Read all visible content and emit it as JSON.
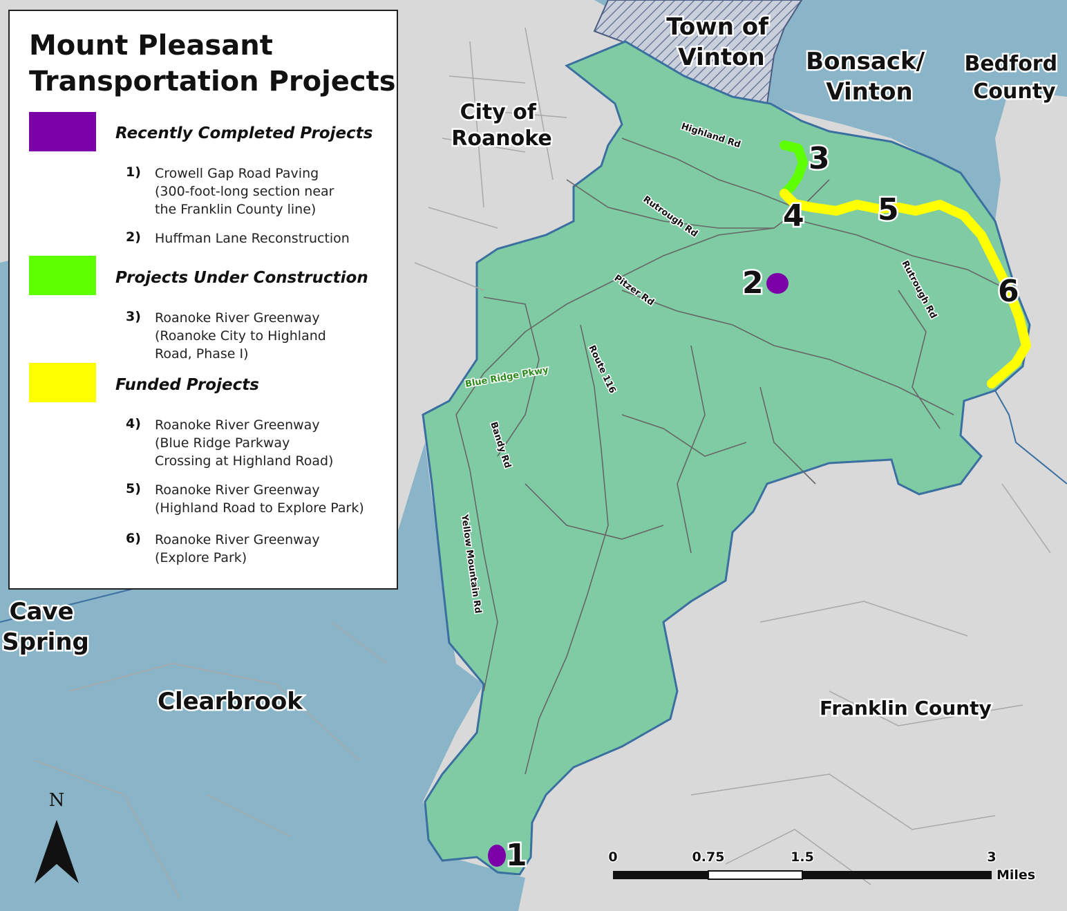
{
  "legend": {
    "title_line1": "Mount Pleasant",
    "title_line2": "Transportation Projects",
    "categories": [
      {
        "label": "Recently Completed Projects",
        "color": "#7b00a8",
        "items": [
          {
            "num": "1)",
            "text": "Crowell Gap Road Paving\n(300-foot-long section near\nthe Franklin County line)"
          },
          {
            "num": "2)",
            "text": "Huffman Lane Reconstruction"
          }
        ]
      },
      {
        "label": "Projects Under Construction",
        "color": "#5eff00",
        "items": [
          {
            "num": "3)",
            "text": "Roanoke River Greenway\n(Roanoke City to Highland\nRoad, Phase I)"
          }
        ]
      },
      {
        "label": "Funded Projects",
        "color": "#ffff00",
        "items": [
          {
            "num": "4)",
            "text": "Roanoke River Greenway\n(Blue Ridge Parkway\nCrossing at Highland Road)"
          },
          {
            "num": "5)",
            "text": "Roanoke River Greenway\n(Highland Road to Explore Park)"
          },
          {
            "num": "6)",
            "text": "Roanoke River Greenway\n(Explore Park)"
          }
        ]
      }
    ]
  },
  "places": {
    "vinton_town": [
      "Town of",
      "Vinton"
    ],
    "bonsack": [
      "Bonsack/",
      "Vinton"
    ],
    "bedford": [
      "Bedford",
      "County"
    ],
    "roanoke_city": [
      "City of",
      "Roanoke"
    ],
    "cave_spring": [
      "Cave",
      "Spring"
    ],
    "clearbrook": "Clearbrook",
    "franklin": "Franklin County"
  },
  "roads": {
    "highland": "Highland Rd",
    "rutrough_west": "Rutrough Rd",
    "rutrough_east": "Rutrough Rd",
    "pitzer": "Pitzer Rd",
    "route116": "Route 116",
    "parkway": "Blue Ridge Pkwy",
    "bandy": "Bandy Rd",
    "yellow_mountain": "Yellow Mountain Rd"
  },
  "markers": [
    "1",
    "2",
    "3",
    "4",
    "5",
    "6"
  ],
  "north_arrow": {
    "label": "N",
    "icon": "north-arrow-icon"
  },
  "scale_bar": {
    "ticks": [
      "0",
      "0.75",
      "1.5",
      "3"
    ],
    "unit": "Miles"
  },
  "colors": {
    "district": "#7fcba3",
    "county_area": "#8ab5c8",
    "outside": "#d9d9d9",
    "boundary": "#3a6fa0",
    "completed": "#7b00a8",
    "under_construction": "#5eff00",
    "funded": "#ffff00"
  }
}
